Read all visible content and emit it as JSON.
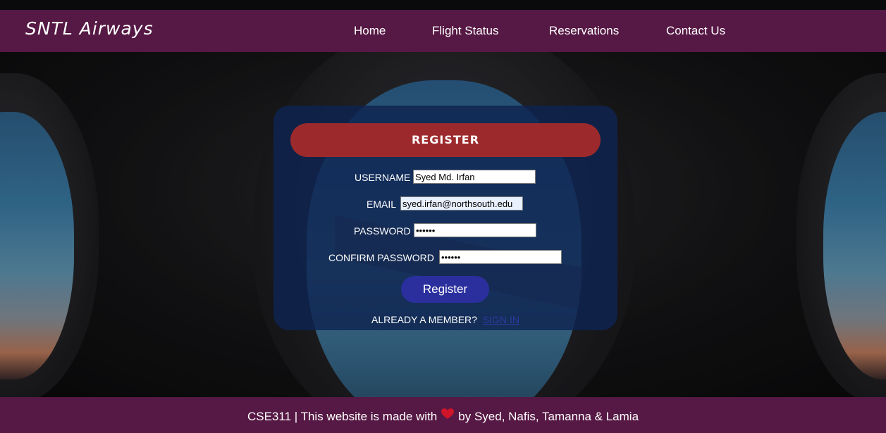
{
  "brand": {
    "logo_text": "SNTL Airways"
  },
  "nav": {
    "items": [
      {
        "label": "Home"
      },
      {
        "label": "Flight Status"
      },
      {
        "label": "Reservations"
      },
      {
        "label": "Contact Us"
      }
    ]
  },
  "register": {
    "title": "REGISTER",
    "fields": {
      "username": {
        "label": "USERNAME",
        "value": "Syed Md. Irfan"
      },
      "email": {
        "label": "EMAIL",
        "value": "syed.irfan@northsouth.edu"
      },
      "password": {
        "label": "PASSWORD",
        "value": "••••••"
      },
      "confirm_password": {
        "label": "CONFIRM PASSWORD",
        "value": "••••••"
      }
    },
    "submit_label": "Register",
    "member_prompt": "ALREADY A MEMBER?",
    "signin_label": "SIGN IN"
  },
  "footer": {
    "text_before": "CSE311 | This website is made with",
    "text_after": "by Syed, Nafis, Tamanna & Lamia",
    "heart_color": "#d0142a"
  },
  "colors": {
    "navbar": "#561844",
    "card_header": "#9c2a2c",
    "button": "#2b2f9e"
  }
}
